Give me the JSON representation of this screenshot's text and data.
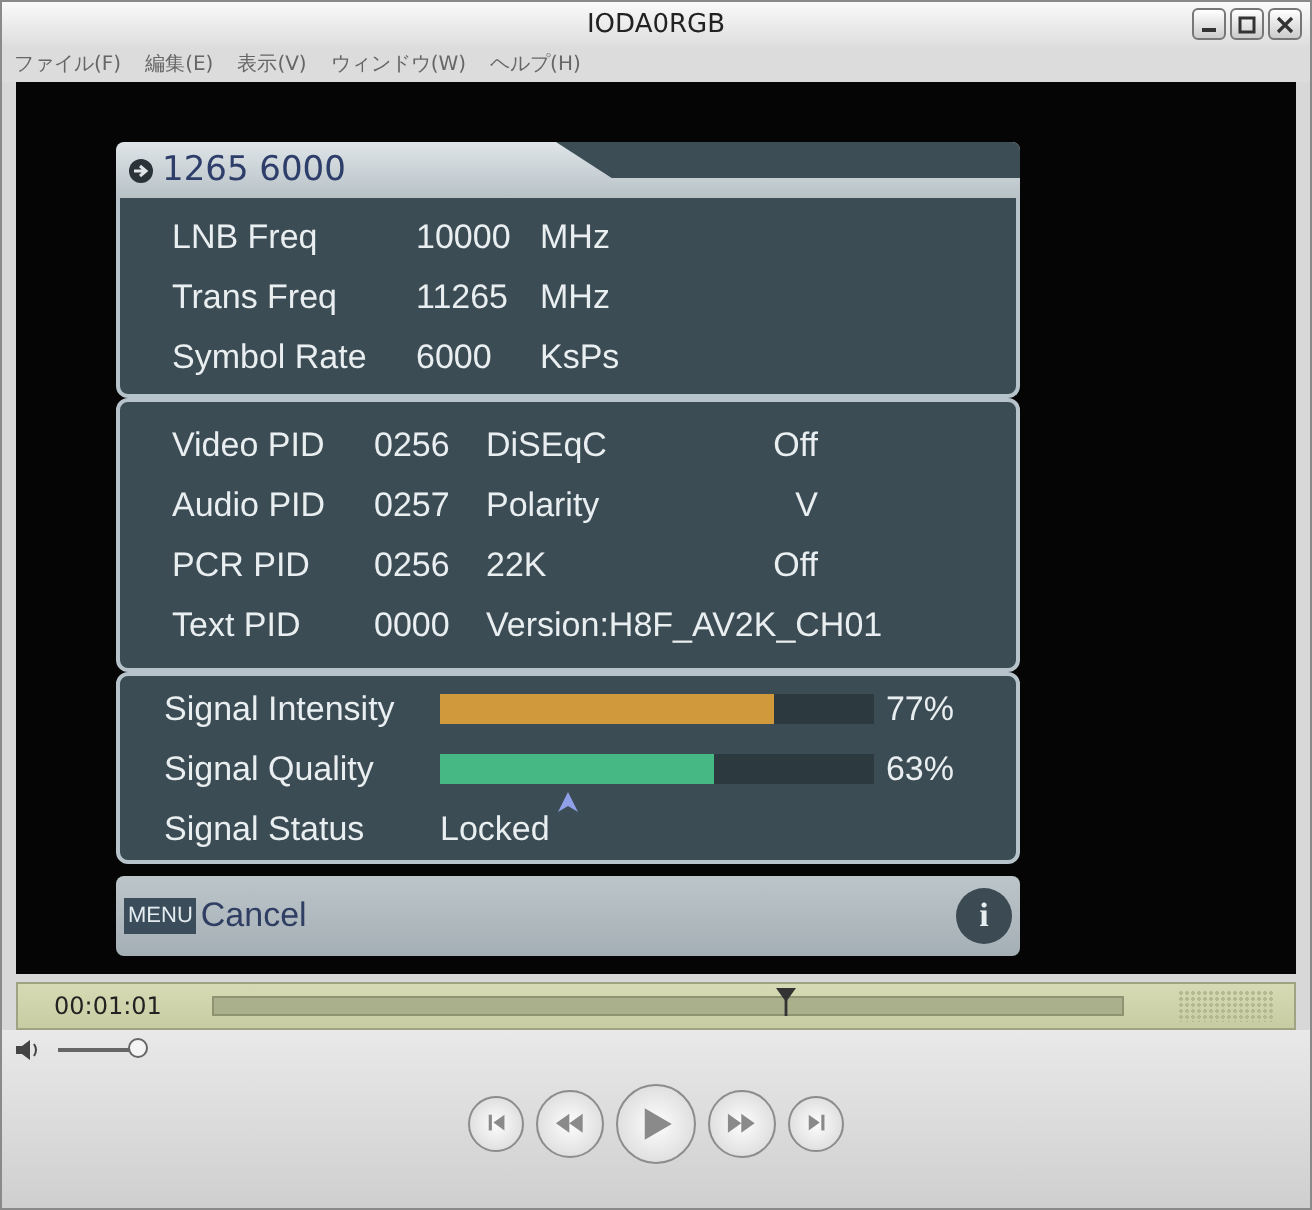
{
  "window": {
    "title": "IODA0RGB"
  },
  "menu": [
    {
      "label": "ファイル(F)"
    },
    {
      "label": "編集(E)"
    },
    {
      "label": "表示(V)"
    },
    {
      "label": "ウィンドウ(W)"
    },
    {
      "label": "ヘルプ(H)"
    }
  ],
  "osd": {
    "header": "1265 6000",
    "tuning": [
      {
        "label": "LNB Freq",
        "value": "10000",
        "unit": "MHz"
      },
      {
        "label": "Trans Freq",
        "value": "11265",
        "unit": "MHz"
      },
      {
        "label": "Symbol Rate",
        "value": "6000",
        "unit": "KsPs"
      }
    ],
    "pids": [
      {
        "label": "Video PID",
        "value": "0256",
        "param": "DiSEqC",
        "setting": "Off"
      },
      {
        "label": "Audio PID",
        "value": "0257",
        "param": "Polarity",
        "setting": "V"
      },
      {
        "label": "PCR PID",
        "value": "0256",
        "param": "22K",
        "setting": "Off"
      },
      {
        "label": "Text PID",
        "value": "0000",
        "param": "Version:H8F_AV2K_CH01"
      }
    ],
    "signals": [
      {
        "kind": "bar",
        "label": "Signal Intensity",
        "level": 0.77,
        "reading": "77%",
        "color": "#d09a3c"
      },
      {
        "kind": "bar",
        "label": "Signal Quality",
        "level": 0.63,
        "reading": "63%",
        "color": "#46b884"
      },
      {
        "kind": "text",
        "label": "Signal Status",
        "value": "Locked"
      }
    ],
    "footer": {
      "key": "MENU",
      "action": "Cancel",
      "info": "i"
    }
  },
  "player": {
    "time": "00:01:01",
    "position": {
      "level": 0.63
    },
    "volume": {
      "level": 1.0
    },
    "buttons": [
      {
        "kind": "start"
      },
      {
        "kind": "rewind"
      },
      {
        "kind": "play"
      },
      {
        "kind": "forward"
      },
      {
        "kind": "end"
      }
    ]
  }
}
